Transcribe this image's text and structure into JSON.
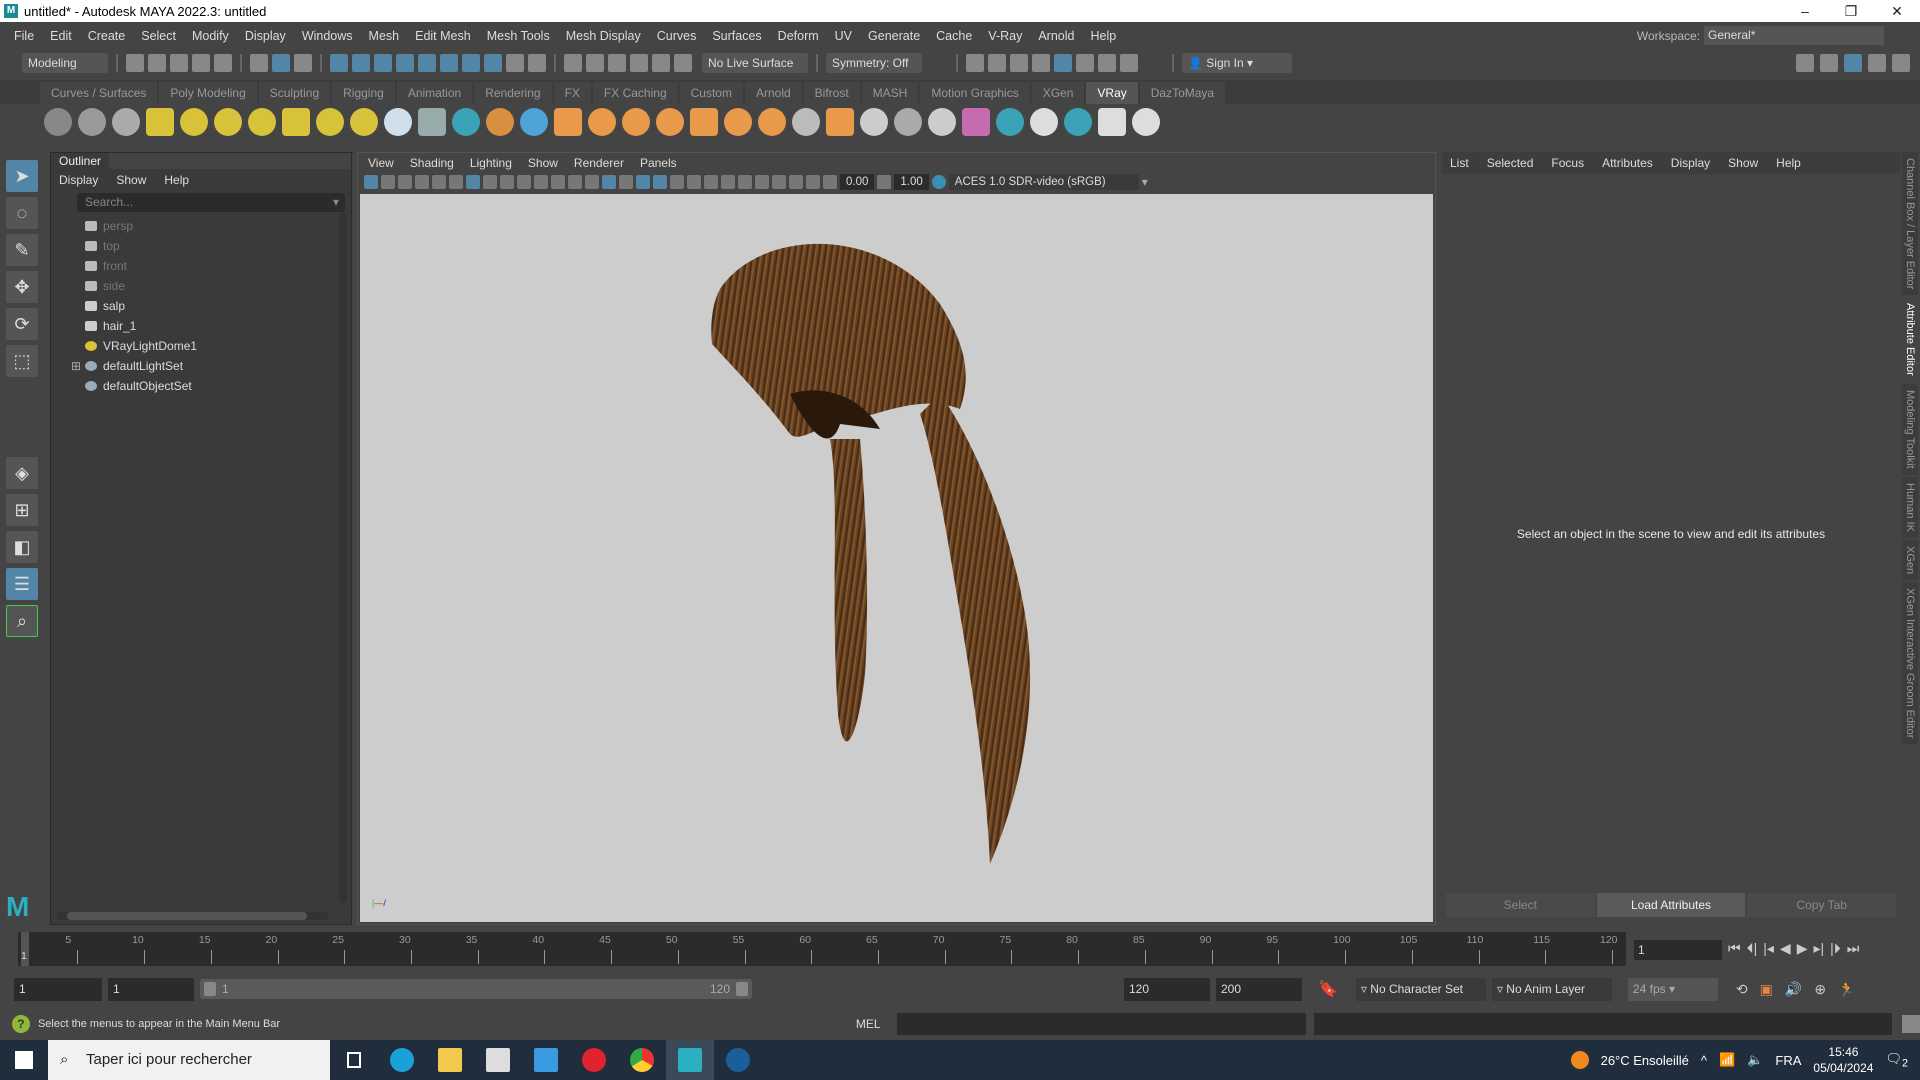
{
  "window": {
    "title": "untitled* - Autodesk MAYA 2022.3: untitled",
    "logo": "M",
    "minimize": "–",
    "maximize": "❐",
    "close": "✕"
  },
  "menubar": {
    "items": [
      "File",
      "Edit",
      "Create",
      "Select",
      "Modify",
      "Display",
      "Windows",
      "Mesh",
      "Edit Mesh",
      "Mesh Tools",
      "Mesh Display",
      "Curves",
      "Surfaces",
      "Deform",
      "UV",
      "Generate",
      "Cache",
      "V-Ray",
      "Arnold",
      "Help"
    ],
    "workspace_label": "Workspace:",
    "workspace_value": "General*"
  },
  "statusline": {
    "mode": "Modeling",
    "live_surface": "No Live Surface",
    "symmetry": "Symmetry: Off",
    "sign_in": "Sign In"
  },
  "shelf": {
    "tabs": [
      "Curves / Surfaces",
      "Poly Modeling",
      "Sculpting",
      "Rigging",
      "Animation",
      "Rendering",
      "FX",
      "FX Caching",
      "Custom",
      "Arnold",
      "Bifrost",
      "MASH",
      "Motion Graphics",
      "XGen",
      "VRay",
      "DazToMaya"
    ],
    "active_tab": "VRay",
    "icon_colors": [
      "#888",
      "#999",
      "#aaa",
      "#d8c23a",
      "#d8c23a",
      "#d8c23a",
      "#d8c23a",
      "#d8c23a",
      "#d8c23a",
      "#d8c23a",
      "#cfe0ea",
      "#9aa",
      "#3aa3b8",
      "#d89040",
      "#4fa3d8",
      "#e89a4a",
      "#e89a4a",
      "#e89a4a",
      "#e89a4a",
      "#e89a4a",
      "#e89a4a",
      "#e89a4a",
      "#bbb",
      "#e89a4a",
      "#ccc",
      "#aaa",
      "#ccc",
      "#c66bb0",
      "#3aa3b8",
      "#ddd",
      "#3aa3b8",
      "#ddd",
      "#ddd"
    ]
  },
  "outliner": {
    "title": "Outliner",
    "menu": [
      "Display",
      "Show",
      "Help"
    ],
    "search_placeholder": "Search...",
    "items": [
      {
        "label": "persp",
        "type": "camera"
      },
      {
        "label": "top",
        "type": "camera"
      },
      {
        "label": "front",
        "type": "camera"
      },
      {
        "label": "side",
        "type": "camera"
      },
      {
        "label": "salp",
        "type": "mesh"
      },
      {
        "label": "hair_1",
        "type": "mesh"
      },
      {
        "label": "VRayLightDome1",
        "type": "light"
      },
      {
        "label": "defaultLightSet",
        "type": "set"
      },
      {
        "label": "defaultObjectSet",
        "type": "set"
      }
    ]
  },
  "viewport": {
    "menu": [
      "View",
      "Shading",
      "Lighting",
      "Show",
      "Renderer",
      "Panels"
    ],
    "exposure": "0.00",
    "gamma": "1.00",
    "color_space": "ACES 1.0 SDR-video (sRGB)",
    "hair_color": "#6b4423"
  },
  "attribute_editor": {
    "menu": [
      "List",
      "Selected",
      "Focus",
      "Attributes",
      "Display",
      "Show",
      "Help"
    ],
    "message": "Select an object in the scene to view and edit its attributes",
    "buttons": [
      "Select",
      "Load Attributes",
      "Copy Tab"
    ]
  },
  "side_tabs": [
    "Channel Box / Layer Editor",
    "Attribute Editor",
    "Modeling Toolkit",
    "Human IK",
    "XGen",
    "XGen Interactive Groom Editor"
  ],
  "timeline": {
    "ticks": [
      5,
      10,
      15,
      20,
      25,
      30,
      35,
      40,
      45,
      50,
      55,
      60,
      65,
      70,
      75,
      80,
      85,
      90,
      95,
      100,
      105,
      110,
      115,
      120
    ],
    "current_frame": "1",
    "start": 1,
    "end": 120
  },
  "playback": {
    "buttons": [
      "⏮",
      "⏴|",
      "|◂",
      "◀",
      "▶",
      "▸|",
      "|⏵",
      "⏭"
    ]
  },
  "range": {
    "start": "1",
    "playback_start": "1",
    "range_start": "1",
    "range_end": "120",
    "playback_end": "120",
    "end": "200",
    "character_set": "No Character Set",
    "anim_layer": "No Anim Layer",
    "fps": "24 fps"
  },
  "commandline": {
    "help": "Select the menus to appear in the Main Menu Bar",
    "lang": "MEL"
  },
  "taskbar": {
    "search": "Taper ici pour rechercher",
    "weather": "26°C  Ensoleillé",
    "lang": "FRA",
    "time": "15:46",
    "date": "05/04/2024",
    "notifications": "2"
  }
}
